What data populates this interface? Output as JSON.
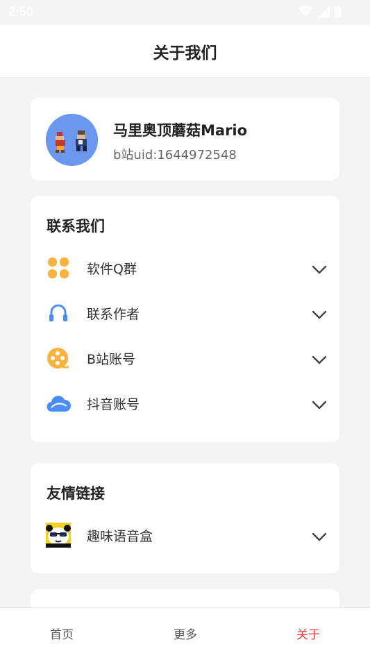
{
  "status": {
    "time": "2:50"
  },
  "header": {
    "title": "关于我们"
  },
  "profile": {
    "name": "马里奥顶蘑菇Mario",
    "uid": "b站uid:1644972548"
  },
  "contact": {
    "title": "联系我们",
    "items": [
      {
        "label": "软件Q群",
        "icon": "grid-icon"
      },
      {
        "label": "联系作者",
        "icon": "headphones-icon"
      },
      {
        "label": "B站账号",
        "icon": "film-reel-icon"
      },
      {
        "label": "抖音账号",
        "icon": "cloud-icon"
      }
    ]
  },
  "links": {
    "title": "友情链接",
    "items": [
      {
        "label": "趣味语音盒",
        "icon": "panda-avatar-icon"
      }
    ]
  },
  "tabs": [
    {
      "label": "首页"
    },
    {
      "label": "更多"
    },
    {
      "label": "关于",
      "active": true
    }
  ],
  "colors": {
    "accent": "#ee3b3b",
    "orange": "#f8b33f",
    "blue": "#4b8df3"
  }
}
